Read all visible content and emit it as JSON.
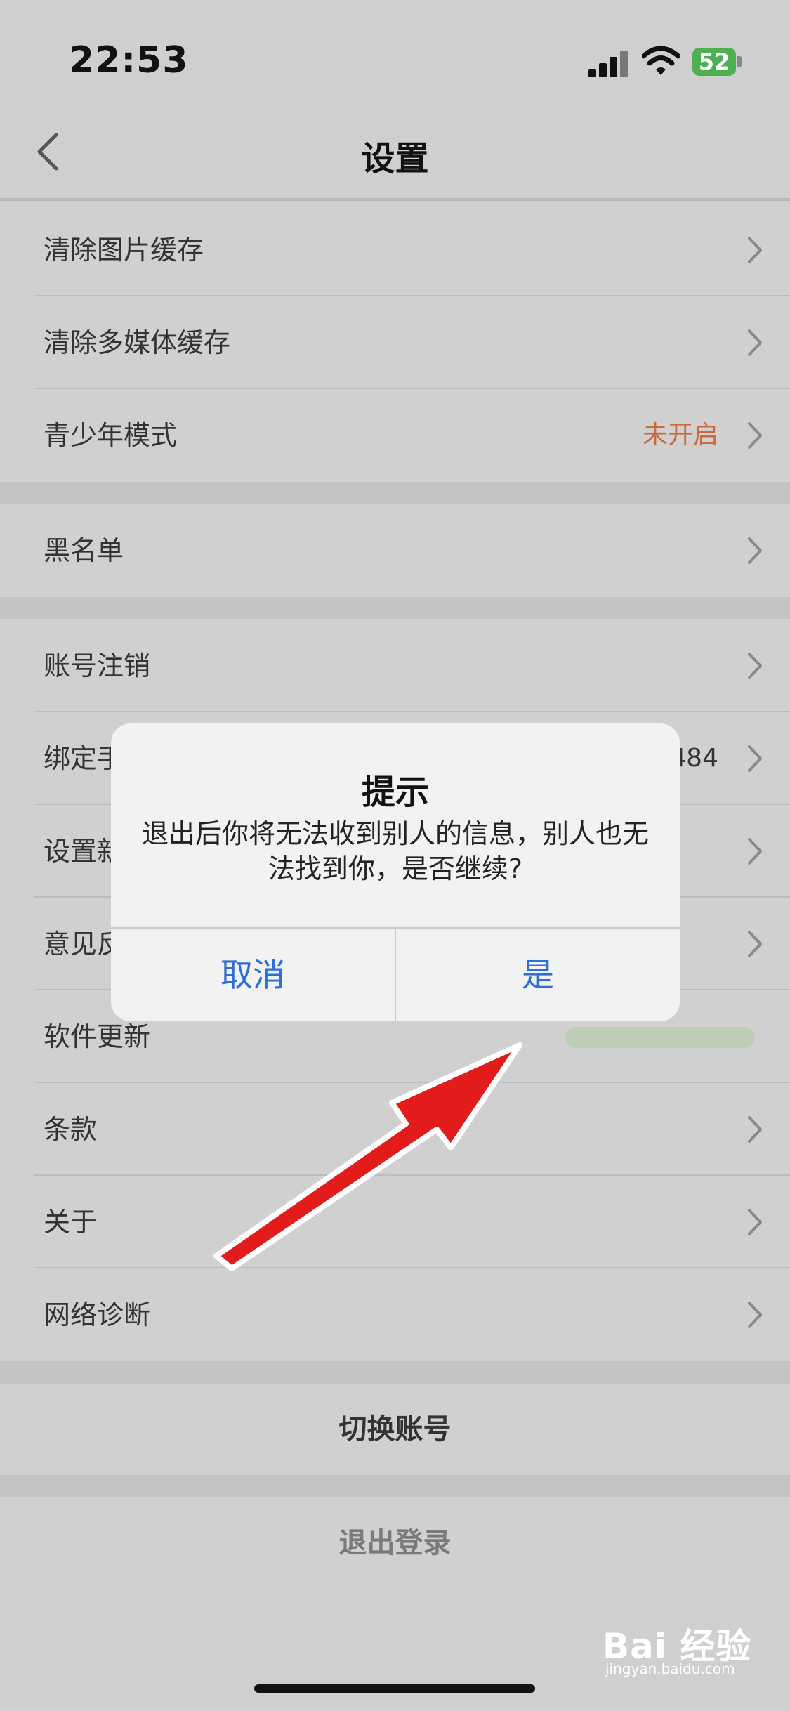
{
  "status_bar": {
    "time": "22:53",
    "battery": "52"
  },
  "nav": {
    "title": "设置"
  },
  "groups": [
    {
      "rows": [
        {
          "label": "清除图片缓存"
        },
        {
          "label": "清除多媒体缓存"
        },
        {
          "label": "青少年模式",
          "value": "未开启"
        }
      ]
    },
    {
      "rows": [
        {
          "label": "黑名单"
        }
      ]
    },
    {
      "rows": [
        {
          "label": "账号注销"
        },
        {
          "label": "绑定手",
          "value": "484"
        },
        {
          "label": "设置新"
        },
        {
          "label": "意见反"
        },
        {
          "label": "软件更新"
        },
        {
          "label": "条款"
        },
        {
          "label": "关于"
        },
        {
          "label": "网络诊断"
        }
      ]
    }
  ],
  "buttons": {
    "switch_account": "切换账号",
    "logout": "退出登录"
  },
  "dialog": {
    "title": "提示",
    "message": "退出后你将无法收到别人的信息，别人也无法找到你，是否继续?",
    "cancel": "取消",
    "confirm": "是"
  },
  "watermark": {
    "brand": "Bai 经验",
    "url": "jingyan.baidu.com"
  },
  "colors": {
    "value_orange": "#c96a3c",
    "dialog_button_blue": "#2d6fd4",
    "battery_green": "#4caf50"
  }
}
